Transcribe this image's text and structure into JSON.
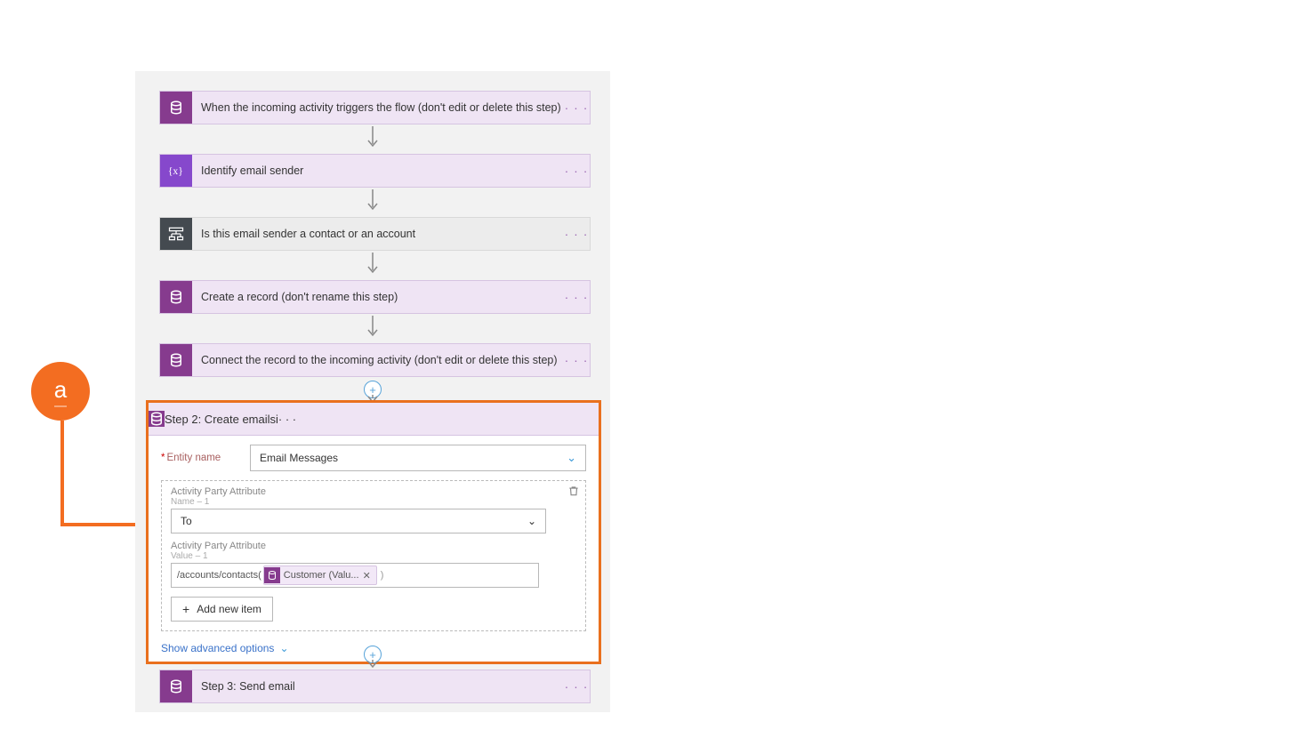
{
  "annotation": {
    "label": "a"
  },
  "steps": [
    {
      "label": "When the incoming activity triggers the flow (don't edit or delete this step)",
      "icon": "database",
      "style": "purple"
    },
    {
      "label": "Identify email sender",
      "icon": "variable",
      "style": "violet"
    },
    {
      "label": "Is this email sender a contact or an account",
      "icon": "switch",
      "style": "dark"
    },
    {
      "label": "Create a record (don't rename this step)",
      "icon": "database",
      "style": "purple"
    },
    {
      "label": "Connect the record to the incoming activity (don't edit or delete this step)",
      "icon": "database",
      "style": "purple"
    }
  ],
  "expanded": {
    "title": "Step 2: Create emails",
    "entity": {
      "label": "Entity name",
      "value": "Email Messages"
    },
    "party_name": {
      "group": "Activity Party Attribute",
      "sub": "Name – 1",
      "value": "To"
    },
    "party_value": {
      "group": "Activity Party Attribute",
      "sub": "Value – 1",
      "prefix": "/accounts/contacts(",
      "token": "Customer (Valu...",
      "suffix": ")"
    },
    "add_item": "Add new item",
    "advanced": "Show advanced options"
  },
  "final_step": {
    "label": "Step 3: Send email",
    "icon": "database",
    "style": "purple"
  }
}
